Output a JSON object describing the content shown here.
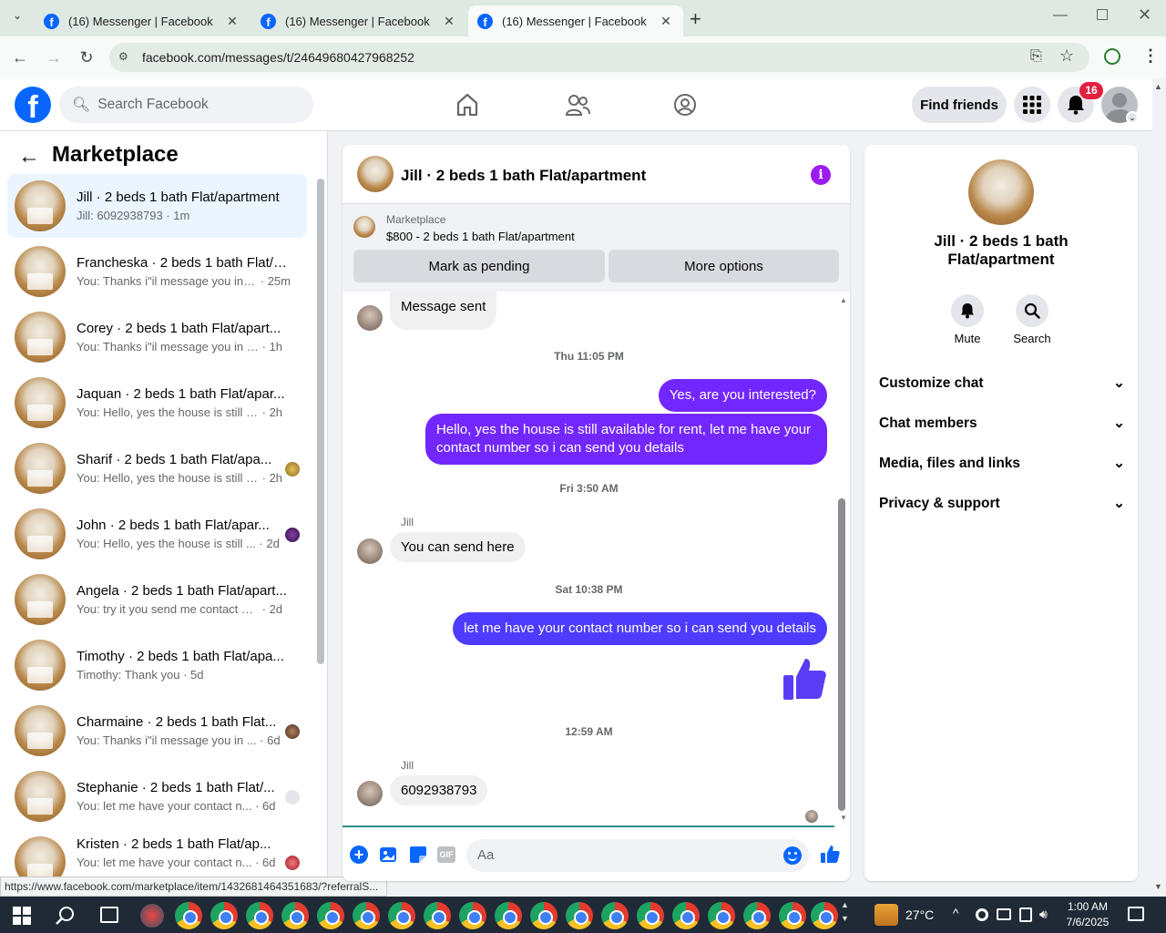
{
  "browser": {
    "tabs": [
      {
        "title": "(16) Messenger | Facebook"
      },
      {
        "title": "(16) Messenger | Facebook"
      },
      {
        "title": "(16) Messenger | Facebook"
      }
    ],
    "url": "facebook.com/messages/t/24649680427968252",
    "status_url": "https://www.facebook.com/marketplace/item/1432681464351683/?referralS..."
  },
  "header": {
    "search_placeholder": "Search Facebook",
    "find_friends": "Find friends",
    "notification_count": "16"
  },
  "sidebar": {
    "title": "Marketplace",
    "conversations": [
      {
        "name": "Jill · 2 beds 1 bath Flat/apartment",
        "snippet": "Jill: 6092938793",
        "time": "· 1m",
        "selected": true
      },
      {
        "name": "Francheska · 2 beds 1 bath Flat/a...",
        "snippet": "You: Thanks i\"il message you in a...",
        "time": "· 25m"
      },
      {
        "name": "Corey · 2 beds 1 bath Flat/apart...",
        "snippet": "You: Thanks i\"il message you in a ...",
        "time": "· 1h"
      },
      {
        "name": "Jaquan · 2 beds 1 bath Flat/apar...",
        "snippet": "You: Hello, yes the house is still avai...",
        "time": "· 2h"
      },
      {
        "name": "Sharif · 2 beds 1 bath Flat/apa...",
        "snippet": "You: Hello, yes the house is still a...",
        "time": "· 2h"
      },
      {
        "name": "John · 2 beds 1 bath Flat/apar...",
        "snippet": "You: Hello, yes the house is still ...",
        "time": "· 2d"
      },
      {
        "name": "Angela · 2 beds 1 bath Flat/apart...",
        "snippet": "You: try it you send me contact nu...",
        "time": "· 2d"
      },
      {
        "name": "Timothy · 2 beds 1 bath Flat/apa...",
        "snippet": "Timothy: Thank you",
        "time": "· 5d"
      },
      {
        "name": "Charmaine · 2 beds 1 bath Flat...",
        "snippet": "You: Thanks i\"il message you in ...",
        "time": "· 6d"
      },
      {
        "name": "Stephanie · 2 beds 1 bath Flat/...",
        "snippet": "You: let me have your contact n...",
        "time": "· 6d"
      },
      {
        "name": "Kristen · 2 beds 1 bath Flat/ap...",
        "snippet": "You: let me have your contact n...",
        "time": "· 6d"
      }
    ]
  },
  "chat": {
    "title": "Jill · 2 beds 1 bath Flat/apartment",
    "listing_source": "Marketplace",
    "listing": "$800 - 2 beds 1 bath Flat/apartment",
    "mark_pending": "Mark as pending",
    "more_options": "More options",
    "messages": {
      "m1": "Message sent",
      "ts1": "Thu 11:05 PM",
      "m2": "Yes, are you interested?",
      "m3": "Hello, yes the house is still available for rent, let me have your contact number so i can send you details",
      "ts2": "Fri 3:50 AM",
      "sender": "Jill",
      "m4": "You can send here",
      "ts3": "Sat 10:38 PM",
      "m5": "let me have your contact number so i can send you details",
      "ts4": "12:59 AM",
      "m6": "6092938793"
    },
    "composer_placeholder": "Aa"
  },
  "details": {
    "name": "Jill · 2 beds 1 bath Flat/apartment",
    "mute": "Mute",
    "search": "Search",
    "sections": [
      "Customize chat",
      "Chat members",
      "Media, files and links",
      "Privacy & support"
    ]
  },
  "taskbar": {
    "weather": "27°C",
    "time": "1:00 AM",
    "date": "7/6/2025"
  },
  "colors": {
    "accent": "#7327ff",
    "facebook_blue": "#0866ff",
    "composer_icon": "#0866ff"
  }
}
